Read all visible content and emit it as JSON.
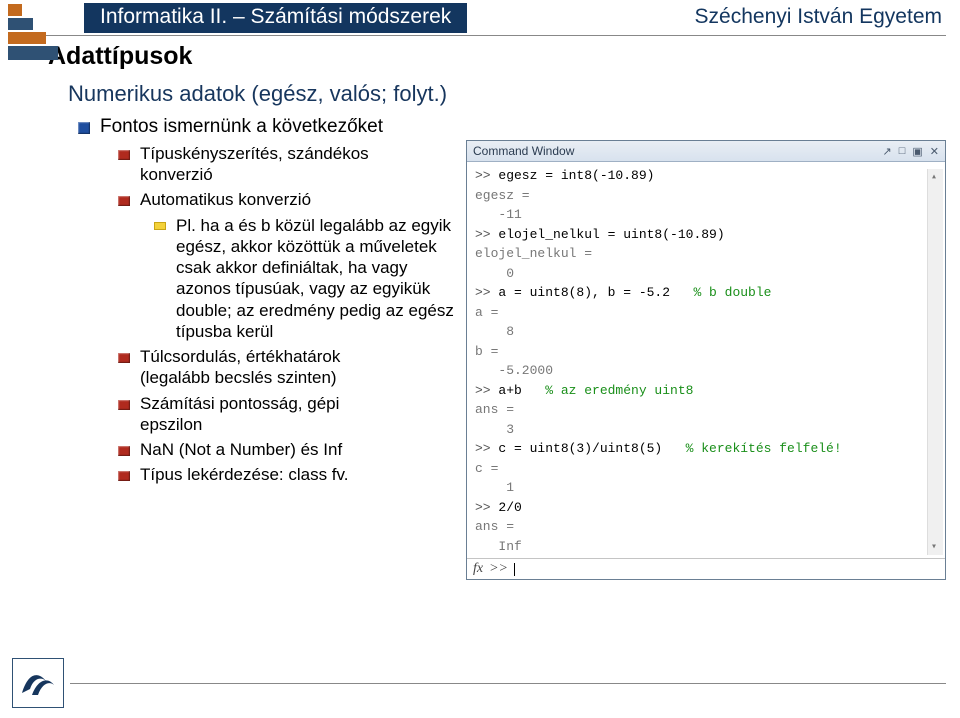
{
  "header": {
    "course": "Informatika II. – Számítási módszerek",
    "university": "Széchenyi István Egyetem"
  },
  "title": "Adattípusok",
  "subtitle": "Numerikus adatok (egész, valós; folyt.)",
  "b1": "Fontos ismernünk a következőket",
  "b2a": "Típuskényszerítés, szándékos konverzió",
  "b2b": "Automatikus konverzió",
  "b3": "Pl. ha a és b közül legalább az egyik egész, akkor közöttük a műveletek csak akkor definiáltak, ha vagy azonos típusúak, vagy az egyikük double; az eredmény pedig az egész típusba kerül",
  "b2c": "Túlcsordulás, értékhatárok (legalább becslés szinten)",
  "b2d": "Számítási pontosság, gépi epszilon",
  "b2e": "NaN (Not a Number) és Inf",
  "b2f": "Típus lekérdezése: class fv.",
  "cmdwin": {
    "title": "Command Window",
    "fx": "fx",
    "lines": [
      {
        "pre": ">> ",
        "body": "egesz = int8(-10.89)"
      },
      {
        "pre": "",
        "body": "egesz =",
        "gray": true
      },
      {
        "pre": "",
        "body": "   -11",
        "gray": true
      },
      {
        "pre": ">> ",
        "body": "elojel_nelkul = uint8(-10.89)"
      },
      {
        "pre": "",
        "body": "elojel_nelkul =",
        "gray": true
      },
      {
        "pre": "",
        "body": "    0",
        "gray": true
      },
      {
        "pre": ">> ",
        "body": "a = uint8(8), b = -5.2",
        "cmt": "   % b double"
      },
      {
        "pre": "",
        "body": "a =",
        "gray": true
      },
      {
        "pre": "",
        "body": "    8",
        "gray": true
      },
      {
        "pre": "",
        "body": "b =",
        "gray": true
      },
      {
        "pre": "",
        "body": "   -5.2000",
        "gray": true
      },
      {
        "pre": ">> ",
        "body": "a+b",
        "cmt": "   % az eredmény uint8"
      },
      {
        "pre": "",
        "body": "ans =",
        "gray": true
      },
      {
        "pre": "",
        "body": "    3",
        "gray": true
      },
      {
        "pre": ">> ",
        "body": "c = uint8(3)/uint8(5)",
        "cmt": "   % kerekítés felfelé!"
      },
      {
        "pre": "",
        "body": "c =",
        "gray": true
      },
      {
        "pre": "",
        "body": "    1",
        "gray": true
      },
      {
        "pre": ">> ",
        "body": "2/0"
      },
      {
        "pre": "",
        "body": "ans =",
        "gray": true
      },
      {
        "pre": "",
        "body": "   Inf",
        "gray": true
      }
    ]
  }
}
